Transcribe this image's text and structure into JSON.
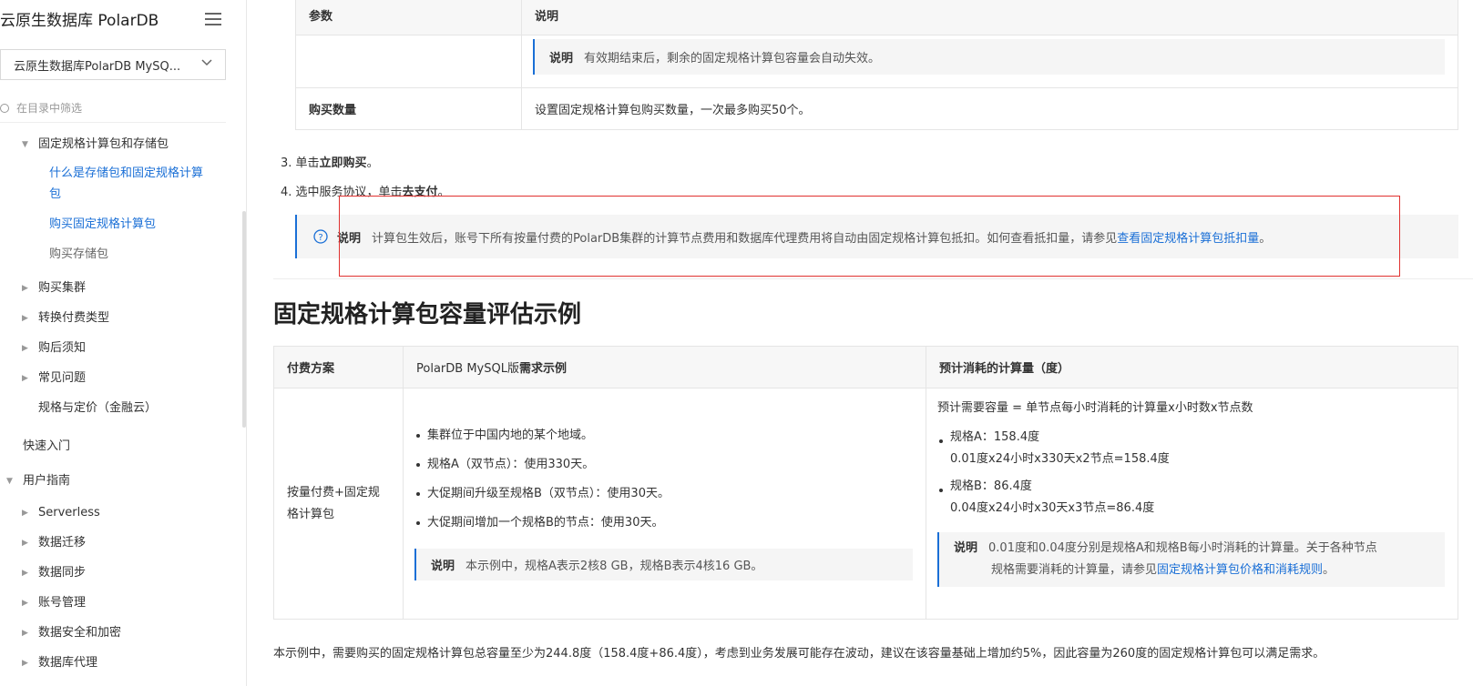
{
  "sidebar": {
    "title": "云原生数据库 PolarDB",
    "select_value": "云原生数据库PolarDB MySQ...",
    "filter_placeholder": "在目录中筛选",
    "items": [
      {
        "label": "固定规格计算包和存储包"
      },
      {
        "label": "什么是存储包和固定规格计算"
      },
      {
        "label": "包"
      },
      {
        "label": "购买固定规格计算包"
      },
      {
        "label": "购买存储包"
      },
      {
        "label": "购买集群"
      },
      {
        "label": "转换付费类型"
      },
      {
        "label": "购后须知"
      },
      {
        "label": "常见问题"
      },
      {
        "label": "规格与定价（金融云）"
      },
      {
        "label": "快速入门"
      },
      {
        "label": "用户指南"
      },
      {
        "label": "Serverless"
      },
      {
        "label": "数据迁移"
      },
      {
        "label": "数据同步"
      },
      {
        "label": "账号管理"
      },
      {
        "label": "数据安全和加密"
      },
      {
        "label": "数据库代理"
      }
    ]
  },
  "top_table": {
    "header_param": "参数",
    "header_desc": "说明",
    "note_label": "说明",
    "note_text": "有效期结束后，剩余的固定规格计算包容量会自动失效。",
    "row2_param": "购买数量",
    "row2_desc": "设置固定规格计算包购买数量，一次最多购买50个。"
  },
  "steps": {
    "s3_prefix": "3. 单击",
    "s3_bold": "立即购买",
    "s3_suffix": "。",
    "s4_prefix": "4. 选中服务协议，单击",
    "s4_bold": "去支付",
    "s4_suffix": "。"
  },
  "highlight_note": {
    "label": "说明",
    "text": "计算包生效后，账号下所有按量付费的PolarDB集群的计算节点费用和数据库代理费用将自动由固定规格计算包抵扣。如何查看抵扣量，请参见",
    "link": "查看固定规格计算包抵扣量",
    "suffix": "。"
  },
  "section_title": "固定规格计算包容量评估示例",
  "example_table": {
    "h1": "付费方案",
    "h2_prefix": "PolarDB MySQL版",
    "h2_bold": "需求示例",
    "h3": "预计消耗的计算量（度）",
    "plan": "按量付费+固定规格计算包",
    "plan_line1": "按量付费+固定规",
    "plan_line2": "格计算包",
    "requirements": [
      "集群位于中国内地的某个地域。",
      "规格A（双节点）：使用330天。",
      "大促期间升级至规格B（双节点）：使用30天。",
      "大促期间增加一个规格B的节点：使用30天。"
    ],
    "req_note_label": "说明",
    "req_note_text": "本示例中，规格A表示2核8 GB，规格B表示4核16 GB。",
    "formula": "预计需要容量 = 单节点每小时消耗的计算量x小时数x节点数",
    "specA_label": "规格A：158.4度",
    "specA_calc": "0.01度x24小时x330天x2节点=158.4度",
    "specB_label": "规格B：86.4度",
    "specB_calc": "0.04度x24小时x30天x3节点=86.4度",
    "calc_note_label": "说明",
    "calc_note_line1": "0.01度和0.04度分别是规格A和规格B每小时消耗的计算量。关于各种节点",
    "calc_note_line2_prefix": "规格需要消耗的计算量，请参见",
    "calc_note_link": "固定规格计算包价格和消耗规则",
    "calc_note_suffix": "。"
  },
  "conclusion": "本示例中，需要购买的固定规格计算包总容量至少为244.8度（158.4度+86.4度），考虑到业务发展可能存在波动，建议在该容量基础上增加约5%，因此容量为260度的固定规格计算包可以满足需求。",
  "colors": {
    "accent": "#1a6fd6",
    "highlight_border": "#e0312f"
  }
}
